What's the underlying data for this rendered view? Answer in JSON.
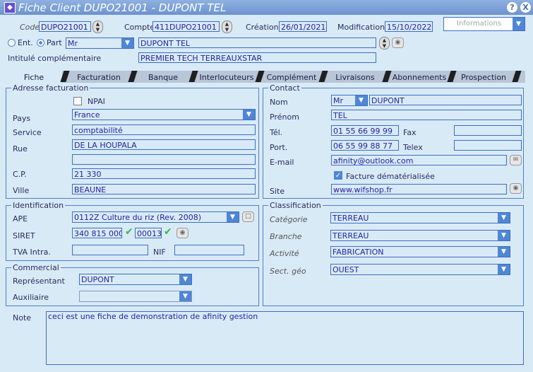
{
  "window": {
    "title": "Fiche Client DUPO21001 - DUPONT TEL",
    "help": "?",
    "close": "X"
  },
  "header": {
    "code_label": "Code",
    "code_value": "DUPO21001",
    "compte_label": "Compte",
    "compte_value": "411DUPO21001",
    "creation_label": "Création",
    "creation_value": "26/01/2021",
    "modification_label": "Modification",
    "modification_value": "15/10/2022",
    "informations_label": "Informations",
    "ent_label": "Ent.",
    "part_label": "Part",
    "civilite": "Mr",
    "nom_value": "DUPONT TEL",
    "intitule_label": "Intitulé complémentaire",
    "intitule_value": "PREMIER TECH TERREAUXSTAR"
  },
  "tabs": [
    "Fiche",
    "Facturation",
    "Banque",
    "Interlocuteurs",
    "Complément",
    "Livraisons",
    "Abonnements",
    "Prospection"
  ],
  "adresse": {
    "legend": "Adresse facturation",
    "npai_label": "NPAI",
    "pays_label": "Pays",
    "pays_value": "France",
    "service_label": "Service",
    "service_value": "comptabilité",
    "rue_label": "Rue",
    "rue_value": "DE LA HOUPALA",
    "rue2_value": "",
    "cp_label": "C.P.",
    "cp_value": "21 330",
    "ville_label": "Ville",
    "ville_value": "BEAUNE"
  },
  "identification": {
    "legend": "Identification",
    "ape_label": "APE",
    "ape_value": "0112Z Culture du riz (Rev. 2008)",
    "siret_label": "SIRET",
    "siret_value": "340 815 000",
    "siret_suffix": "00013",
    "tva_label": "TVA Intra.",
    "tva_value": "",
    "nif_label": "NIF",
    "nif_value": ""
  },
  "commercial": {
    "legend": "Commercial",
    "representant_label": "Représentant",
    "representant_value": "DUPONT",
    "auxiliaire_label": "Auxiliaire",
    "auxiliaire_value": ""
  },
  "contact": {
    "legend": "Contact",
    "nom_label": "Nom",
    "civilite": "Mr",
    "nom_value": "DUPONT",
    "prenom_label": "Prénom",
    "prenom_value": "TEL",
    "tel_label": "Tél.",
    "tel_value": "01 55 66 99 99",
    "fax_label": "Fax",
    "fax_value": "",
    "port_label": "Port.",
    "port_value": "06 55 99 88 77",
    "telex_label": "Telex",
    "telex_value": "",
    "email_label": "E-mail",
    "email_value": "afinity@outlook.com",
    "facture_label": "Facture dématérialisée",
    "site_label": "Site",
    "site_value": "www.wifshop.fr"
  },
  "classification": {
    "legend": "Classification",
    "categorie_label": "Catégorie",
    "categorie_value": "TERREAU",
    "branche_label": "Branche",
    "branche_value": "TERREAU",
    "activite_label": "Activité",
    "activite_value": "FABRICATION",
    "sectgeo_label": "Sect. géo",
    "sectgeo_value": "OUEST"
  },
  "note": {
    "label": "Note",
    "value": "ceci est une fiche de demonstration de afinity gestion"
  }
}
